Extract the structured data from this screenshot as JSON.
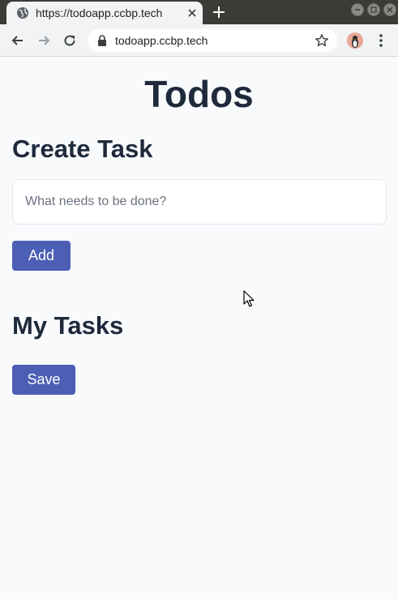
{
  "browser": {
    "tab_title": "https://todoapp.ccbp.tech",
    "url": "todoapp.ccbp.tech"
  },
  "page": {
    "title": "Todos",
    "create_section": {
      "bold": "Create",
      "rest": " Task"
    },
    "input_placeholder": "What needs to be done?",
    "add_label": "Add",
    "tasks_section": {
      "bold": "My",
      "rest": " Tasks"
    },
    "save_label": "Save"
  },
  "colors": {
    "button": "#4c5fb5",
    "page_background": "#f8fafc",
    "text": "#1e293b"
  }
}
